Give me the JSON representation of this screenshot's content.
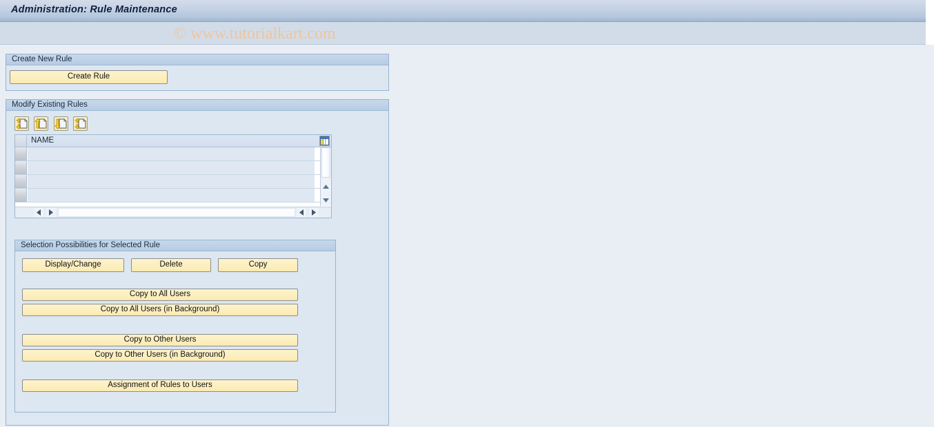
{
  "window": {
    "title": "Administration: Rule Maintenance",
    "watermark": "© www.tutorialkart.com"
  },
  "colors": {
    "title_bar_top": "#d3dcea",
    "title_bar_bottom": "#9fb6d0",
    "canvas_background": "#e9eef5",
    "group_background": "#dde7f1",
    "group_border": "#97b3d0",
    "button_fill": "#fcefc0",
    "button_border": "#8c8c8c",
    "watermark_color": "#f0c49a",
    "title_text": "#10203c"
  },
  "create_new_rule": {
    "group_title": "Create New Rule",
    "create_button": "Create Rule"
  },
  "modify_existing_rules": {
    "group_title": "Modify Existing Rules",
    "toolbar": [
      {
        "name": "rule-insert-icon",
        "tooltip": "Insert Rule"
      },
      {
        "name": "rule-append-icon",
        "tooltip": "Append Rule"
      },
      {
        "name": "rule-download-icon",
        "tooltip": "Download Rule"
      },
      {
        "name": "rule-exchange-icon",
        "tooltip": "Exchange Rule"
      }
    ],
    "table": {
      "columns": [
        "NAME"
      ],
      "rows": [
        {
          "NAME": ""
        },
        {
          "NAME": ""
        },
        {
          "NAME": ""
        },
        {
          "NAME": ""
        }
      ],
      "column_config_icon": "table-settings-icon",
      "vertical_scroll": {
        "up": "▲",
        "down": "▼"
      },
      "horizontal_scroll": {
        "left": "◀",
        "right": "▶"
      }
    }
  },
  "selection_possibilities": {
    "group_title": "Selection Possibilities for Selected Rule",
    "row_buttons": [
      "Display/Change",
      "Delete",
      "Copy"
    ],
    "copy_all_users": "Copy to All Users",
    "copy_all_users_background": "Copy to All Users (in Background)",
    "copy_other_users": "Copy to Other Users",
    "copy_other_users_background": "Copy to Other Users (in Background)",
    "assignment_of_rules": "Assignment of Rules to Users"
  }
}
